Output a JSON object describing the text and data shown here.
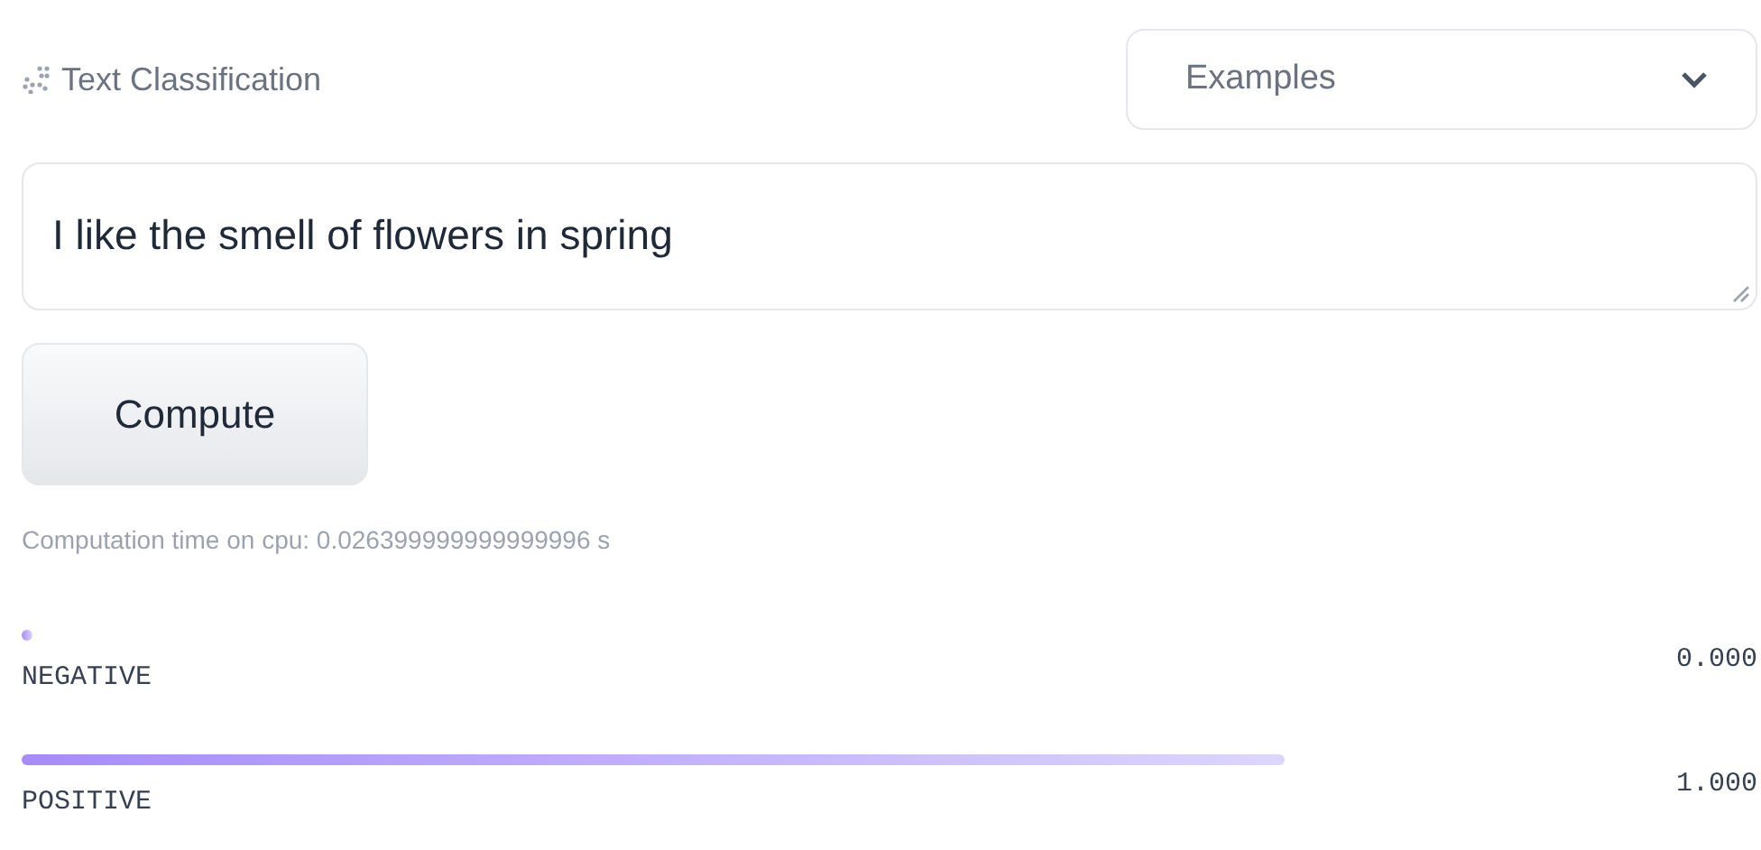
{
  "widget": {
    "title": "Text Classification",
    "examples": {
      "placeholder": "Examples"
    }
  },
  "input": {
    "value": "I like the smell of flowers in spring"
  },
  "compute_button": "Compute",
  "computation_time": "Computation time on cpu: 0.026399999999999996 s",
  "results": [
    {
      "label": "NEGATIVE",
      "score": "0.000"
    },
    {
      "label": "POSITIVE",
      "score": "1.000"
    }
  ]
}
